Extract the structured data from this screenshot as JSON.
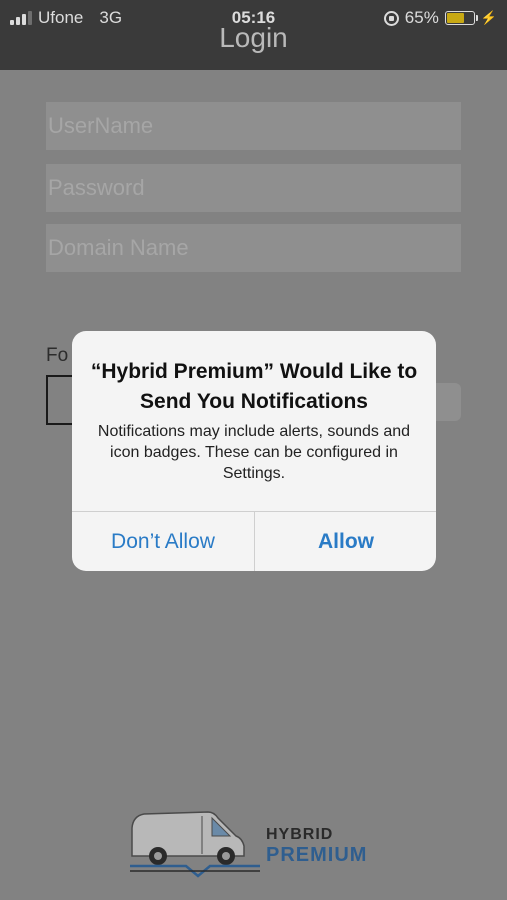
{
  "status_bar": {
    "carrier": "Ufone",
    "network": "3G",
    "time": "05:16",
    "battery_percent": "65%",
    "battery_level": 0.65,
    "battery_color": "#c8a914"
  },
  "nav": {
    "title": "Login"
  },
  "form": {
    "username_placeholder": "UserName",
    "password_placeholder": "Password",
    "domain_placeholder": "Domain Name",
    "forgot_partial": "Fo"
  },
  "alert": {
    "title": "“Hybrid Premium” Would Like to Send You Notifications",
    "message": "Notifications may include alerts, sounds and icon badges. These can be configured in Settings.",
    "deny_label": "Don’t Allow",
    "allow_label": "Allow",
    "button_color": "#2a7bc6"
  },
  "logo": {
    "line1": "HYBRID",
    "line2": "PREMIUM",
    "icon": "van-icon"
  }
}
